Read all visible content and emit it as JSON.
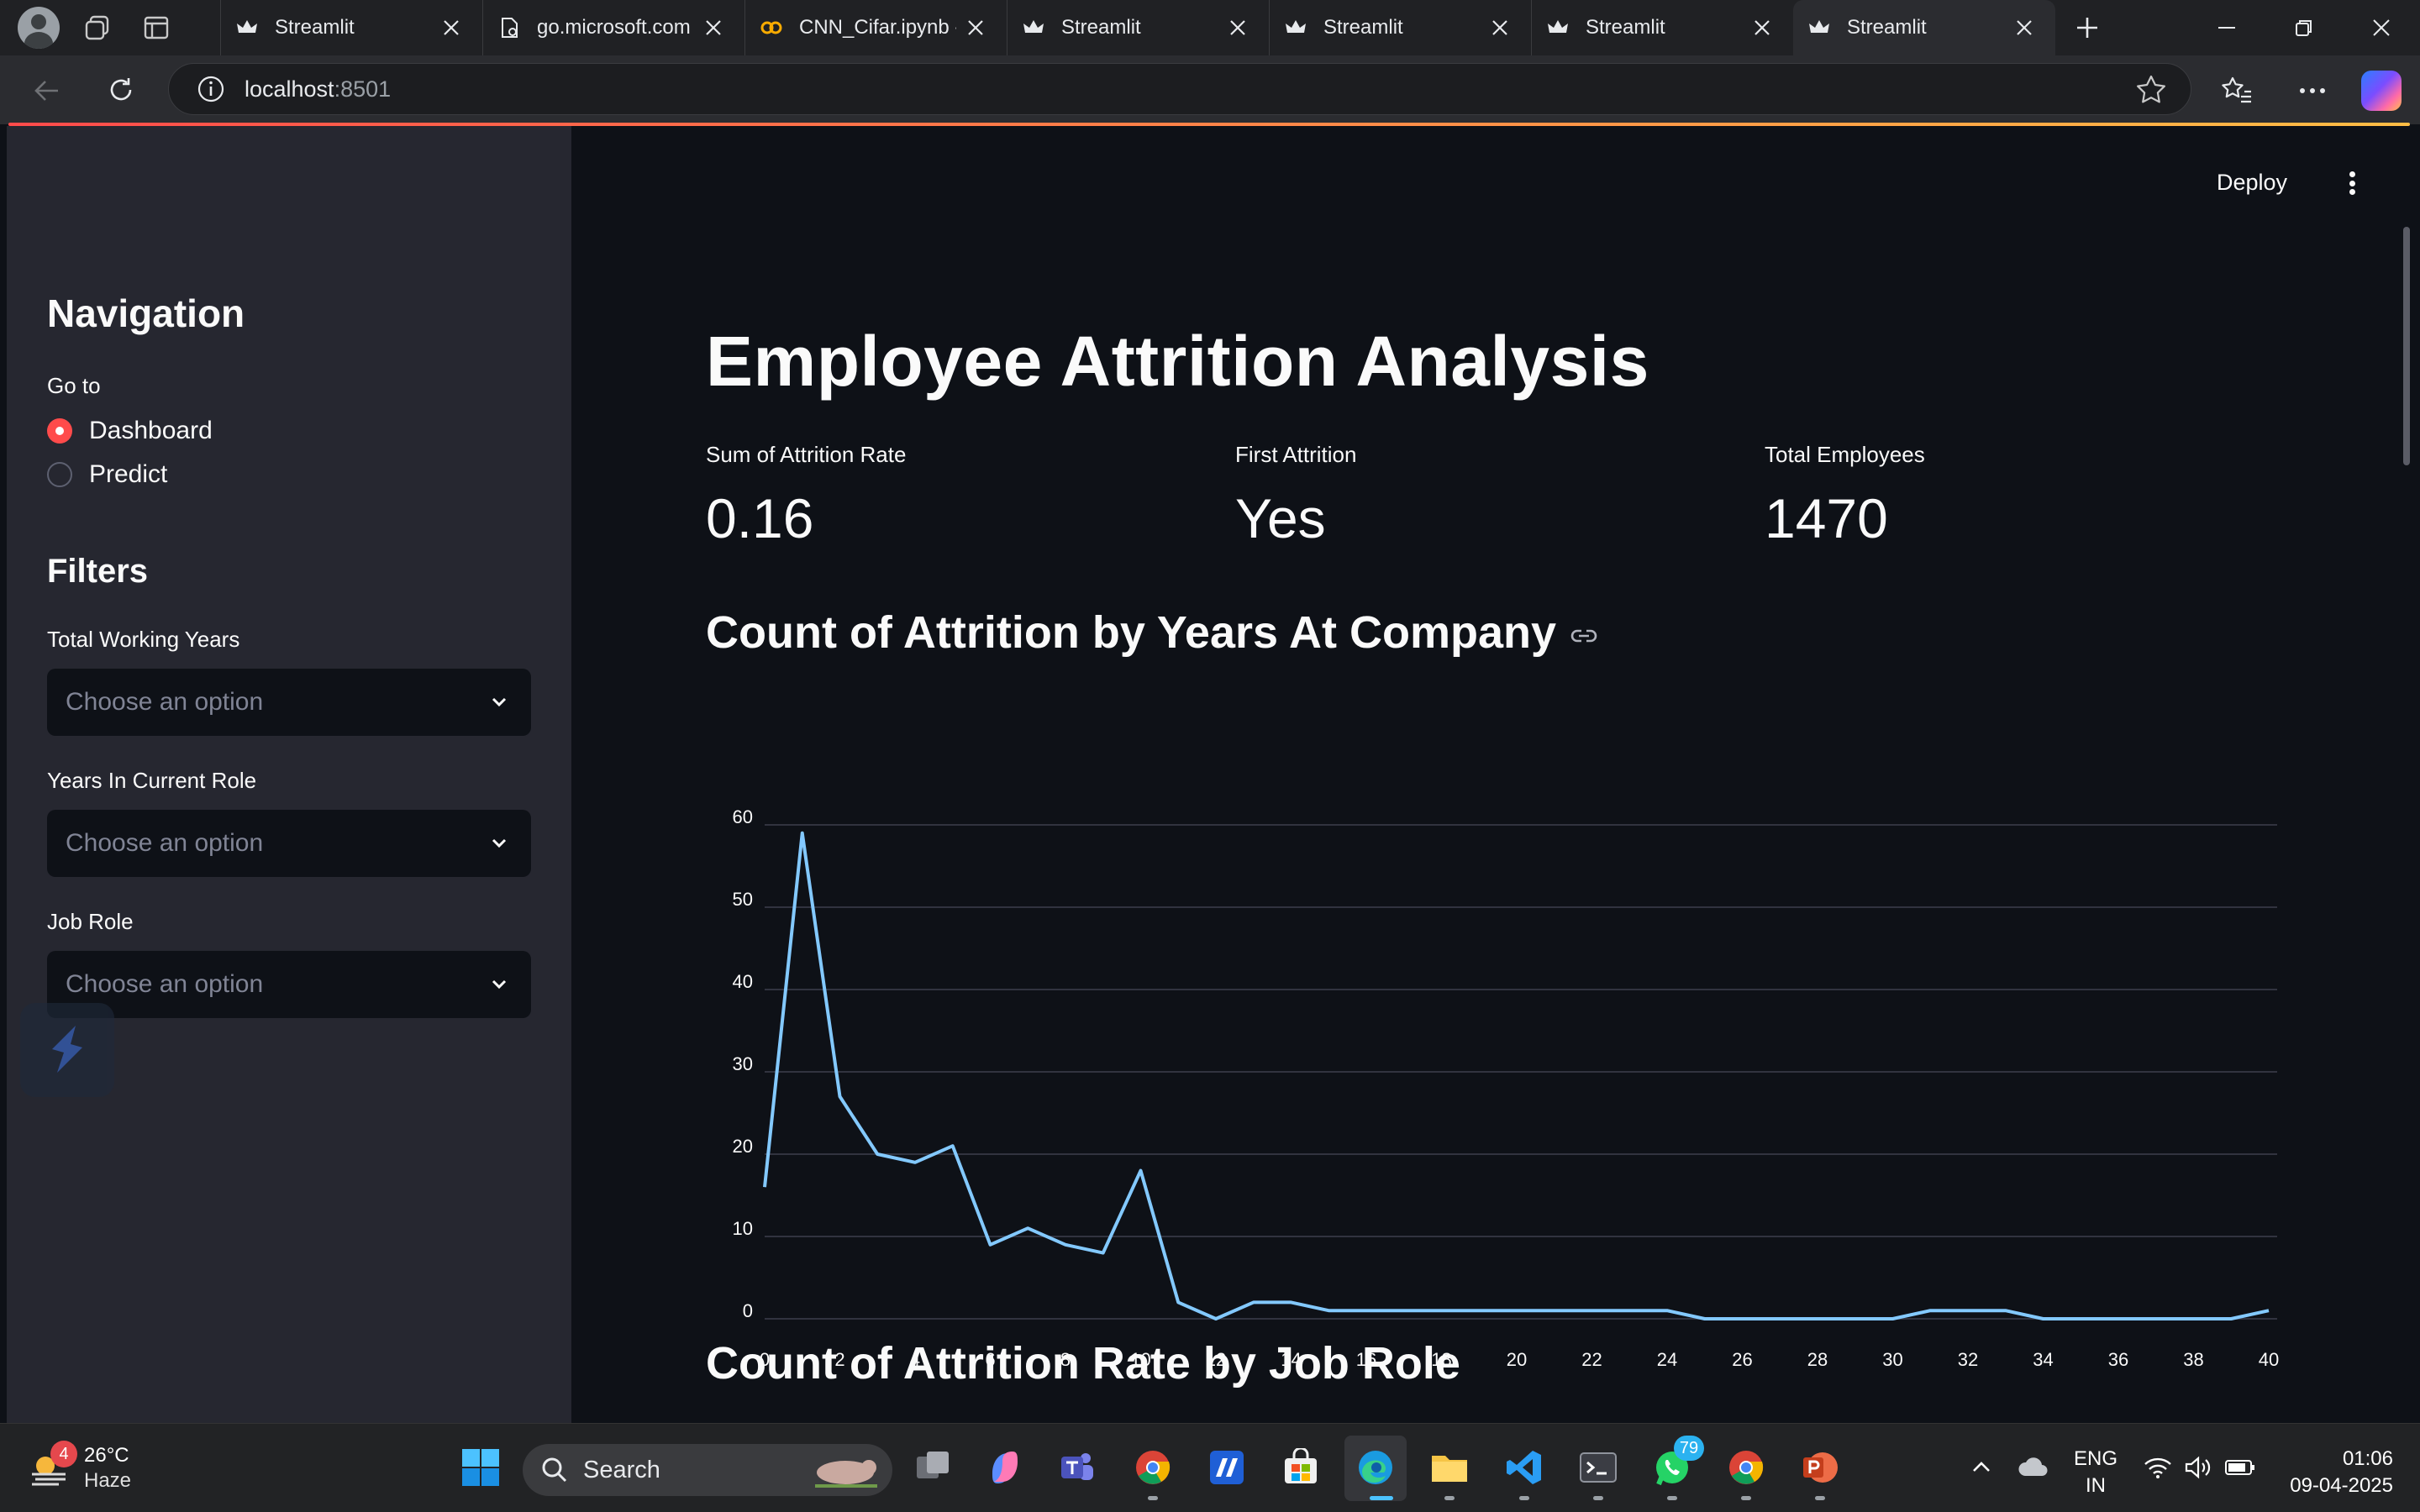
{
  "browser": {
    "tabs": [
      {
        "title": "Streamlit",
        "favicon": "streamlit-crown-icon"
      },
      {
        "title": "go.microsoft.com",
        "favicon": "document-icon"
      },
      {
        "title": "CNN_Cifar.ipynb -",
        "favicon": "colab-icon"
      },
      {
        "title": "Streamlit",
        "favicon": "streamlit-crown-icon"
      },
      {
        "title": "Streamlit",
        "favicon": "streamlit-crown-icon"
      },
      {
        "title": "Streamlit",
        "favicon": "streamlit-crown-icon"
      },
      {
        "title": "Streamlit",
        "favicon": "streamlit-crown-icon",
        "active": true
      }
    ],
    "url_host": "localhost",
    "url_port": ":8501"
  },
  "app": {
    "deploy_label": "Deploy",
    "sidebar": {
      "nav_title": "Navigation",
      "goto_label": "Go to",
      "radio_options": [
        {
          "label": "Dashboard",
          "selected": true
        },
        {
          "label": "Predict",
          "selected": false
        }
      ],
      "filters_title": "Filters",
      "filters": [
        {
          "label": "Total Working Years",
          "placeholder": "Choose an option"
        },
        {
          "label": "Years In Current Role",
          "placeholder": "Choose an option"
        },
        {
          "label": "Job Role",
          "placeholder": "Choose an option"
        }
      ]
    },
    "main": {
      "title": "Employee Attrition Analysis",
      "metrics": [
        {
          "label": "Sum of Attrition Rate",
          "value": "0.16"
        },
        {
          "label": "First Attrition",
          "value": "Yes"
        },
        {
          "label": "Total Employees",
          "value": "1470"
        }
      ],
      "chart1_title": "Count of Attrition by Years At Company",
      "chart2_title": "Count of Attrition Rate by Job Role"
    },
    "accent_color": "#ff4b4b",
    "line_color": "#83c9ff"
  },
  "chart_data": {
    "type": "line",
    "title": "Count of Attrition by Years At Company",
    "xlabel": "",
    "ylabel": "",
    "x": [
      0,
      1,
      2,
      3,
      4,
      5,
      6,
      7,
      8,
      9,
      10,
      11,
      12,
      13,
      14,
      15,
      16,
      17,
      18,
      19,
      20,
      21,
      22,
      23,
      24,
      25,
      26,
      27,
      28,
      29,
      30,
      31,
      32,
      33,
      34,
      35,
      36,
      37,
      38,
      39,
      40
    ],
    "series": [
      {
        "values": [
          16,
          59,
          27,
          20,
          19,
          21,
          9,
          11,
          9,
          8,
          18,
          2,
          0,
          2,
          2,
          1,
          1,
          1,
          1,
          1,
          1,
          1,
          1,
          1,
          1,
          0,
          0,
          0,
          0,
          0,
          0,
          1,
          1,
          1,
          0,
          0,
          0,
          0,
          0,
          0,
          1
        ]
      }
    ],
    "x_ticks": [
      0,
      2,
      4,
      6,
      8,
      10,
      12,
      14,
      16,
      18,
      20,
      22,
      24,
      26,
      28,
      30,
      32,
      34,
      36,
      38,
      40
    ],
    "y_ticks": [
      0,
      10,
      20,
      30,
      40,
      50,
      60
    ],
    "xlim": [
      0,
      40
    ],
    "ylim": [
      0,
      60
    ],
    "grid": true,
    "color": "#83c9ff"
  },
  "taskbar": {
    "weather_temp": "26°C",
    "weather_cond": "Haze",
    "weather_badge": "4",
    "search_label": "Search",
    "whatsapp_badge": "79",
    "lang_line1": "ENG",
    "lang_line2": "IN",
    "time": "01:06",
    "date": "09-04-2025"
  }
}
